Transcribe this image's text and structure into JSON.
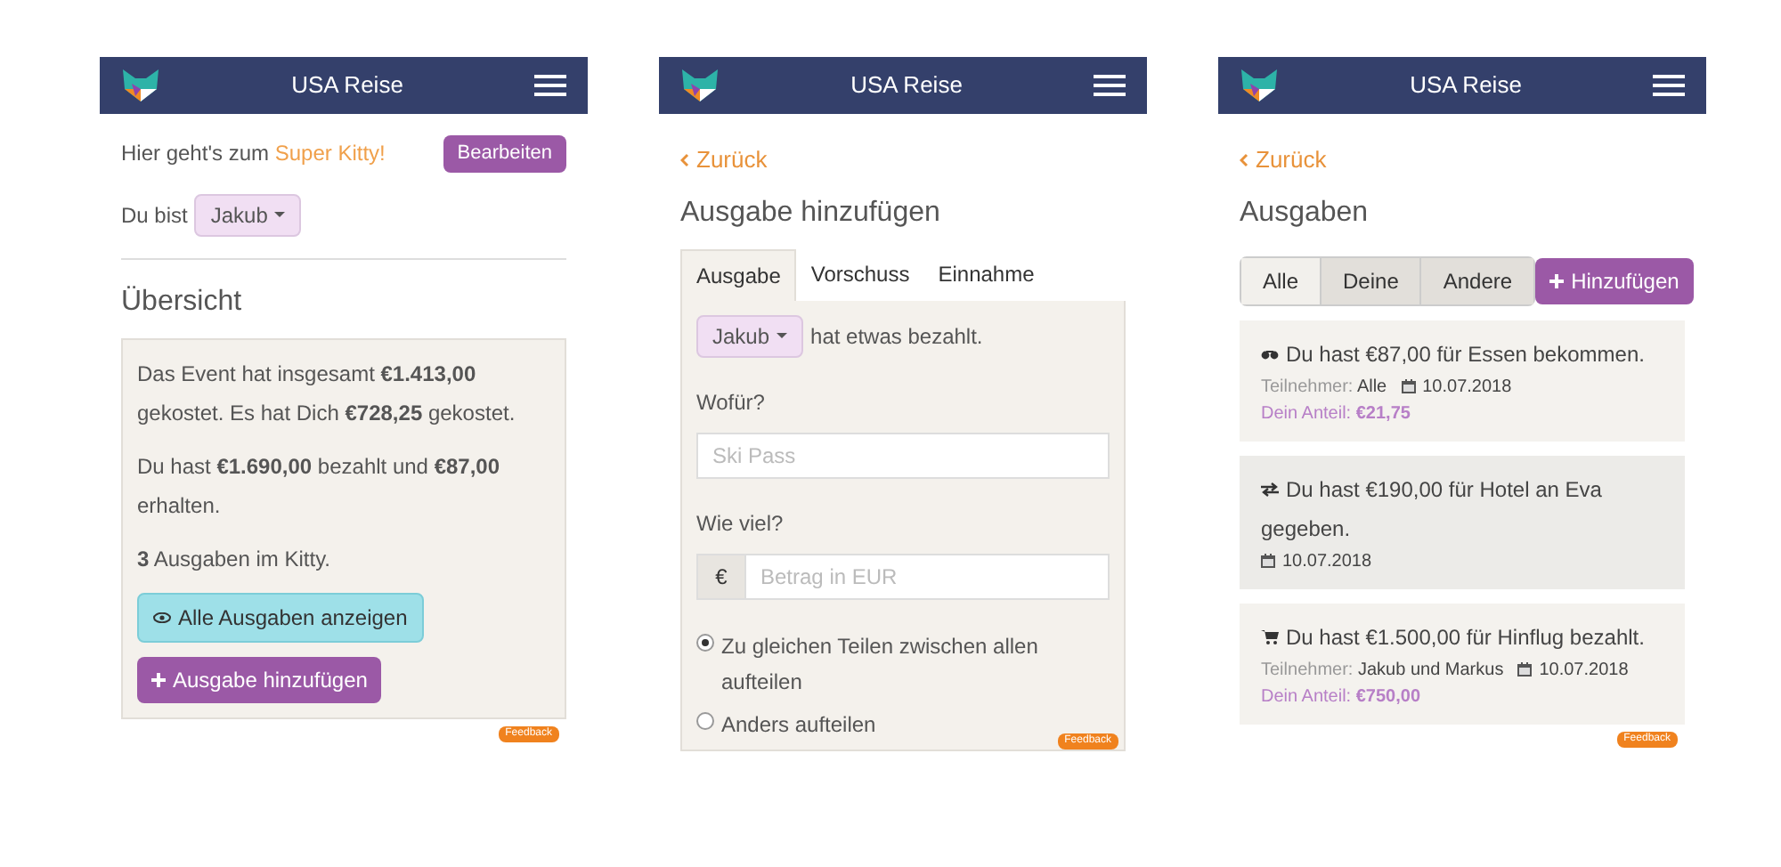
{
  "screens": [
    {
      "kind": "overview",
      "header": {
        "title": "USA Reise"
      },
      "intro_text": "Hier geht's zum",
      "intro_link": "Super Kitty!",
      "edit_button": "Bearbeiten",
      "you_are_label": "Du bist",
      "you_are_value": "Jakub",
      "heading": "Übersicht",
      "paragraphs": [
        "Das Event hat insgesamt **€1.413,00** gekostet. Es hat Dich **€728,25** gekostet.",
        "Du hast **€1.690,00** bezahlt und **€87,00** erhalten.",
        "**3** Ausgaben im Kitty."
      ],
      "show_all_button": "Alle Ausgaben anzeigen",
      "add_button": "Ausgabe hinzufügen",
      "feedback": "Feedback"
    },
    {
      "kind": "add",
      "header": {
        "title": "USA Reise"
      },
      "back": "Zurück",
      "heading": "Ausgabe hinzufügen",
      "tabs": [
        {
          "label": "Ausgabe",
          "selected": true
        },
        {
          "label": "Vorschuss",
          "selected": false
        },
        {
          "label": "Einnahme",
          "selected": false
        }
      ],
      "payer": "Jakub",
      "payer_text": "hat etwas bezahlt.",
      "what_label": "Wofür?",
      "what_placeholder": "Ski Pass",
      "amount_label": "Wie viel?",
      "currency": "€",
      "amount_placeholder": "Betrag in EUR",
      "split_options": [
        {
          "label": "Zu gleichen Teilen zwischen allen aufteilen",
          "selected": true
        },
        {
          "label": "Anders aufteilen",
          "selected": false
        }
      ],
      "feedback": "Feedback"
    },
    {
      "kind": "list",
      "header": {
        "title": "USA Reise"
      },
      "back": "Zurück",
      "heading": "Ausgaben",
      "filters": [
        {
          "label": "Alle",
          "selected": true
        },
        {
          "label": "Deine",
          "selected": false
        },
        {
          "label": "Andere",
          "selected": false
        }
      ],
      "add_button": "Hinzufügen",
      "entries": [
        {
          "kind": "income",
          "text": "Du hast €87,00 für Essen bekommen.",
          "participants_label": "Teilnehmer:",
          "participants": "Alle",
          "date": "10.07.2018",
          "share_label": "Dein Anteil:",
          "share": "€21,75"
        },
        {
          "kind": "transfer",
          "text": "Du hast €190,00 für Hotel an Eva gegeben.",
          "date": "10.07.2018"
        },
        {
          "kind": "expense",
          "text": "Du hast €1.500,00 für Hinflug bezahlt.",
          "participants_label": "Teilnehmer:",
          "participants": "Jakub und Markus",
          "date": "10.07.2018",
          "share_label": "Dein Anteil:",
          "share": "€750,00"
        }
      ],
      "feedback": "Feedback"
    }
  ]
}
